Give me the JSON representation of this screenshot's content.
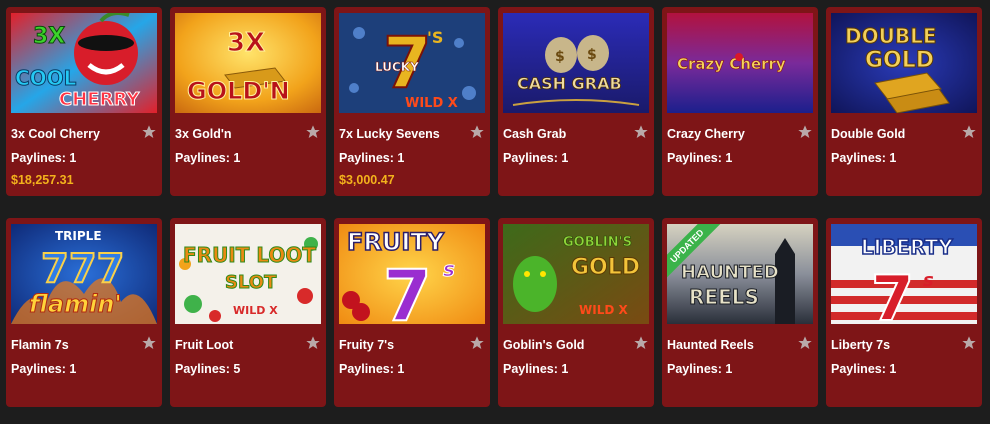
{
  "games": [
    {
      "name": "3x Cool Cherry",
      "paylines": "Paylines: 1",
      "jackpot": "$18,257.31"
    },
    {
      "name": "3x Gold'n",
      "paylines": "Paylines: 1",
      "jackpot": ""
    },
    {
      "name": "7x Lucky Sevens",
      "paylines": "Paylines: 1",
      "jackpot": "$3,000.47"
    },
    {
      "name": "Cash Grab",
      "paylines": "Paylines: 1",
      "jackpot": ""
    },
    {
      "name": "Crazy Cherry",
      "paylines": "Paylines: 1",
      "jackpot": ""
    },
    {
      "name": "Double Gold",
      "paylines": "Paylines: 1",
      "jackpot": ""
    },
    {
      "name": "Flamin 7s",
      "paylines": "Paylines: 1",
      "jackpot": ""
    },
    {
      "name": "Fruit Loot",
      "paylines": "Paylines: 5",
      "jackpot": ""
    },
    {
      "name": "Fruity 7's",
      "paylines": "Paylines: 1",
      "jackpot": ""
    },
    {
      "name": "Goblin's Gold",
      "paylines": "Paylines: 1",
      "jackpot": ""
    },
    {
      "name": "Haunted Reels",
      "paylines": "Paylines: 1",
      "jackpot": "",
      "badge": "UPDATED"
    },
    {
      "name": "Liberty 7s",
      "paylines": "Paylines: 1",
      "jackpot": ""
    }
  ],
  "thumb_text": {
    "cool_cherry": [
      "3X",
      "COOL",
      "CHERRY"
    ],
    "goldn": [
      "3X",
      "GOLD'N"
    ],
    "lucky": [
      "7",
      "'S",
      "LUCKY",
      "WILD X"
    ],
    "cash_grab": [
      "CASH GRAB"
    ],
    "crazy_cherry": [
      "Crazy Cherry"
    ],
    "double_gold": [
      "DOUBLE",
      "GOLD"
    ],
    "flamin": [
      "TRIPLE",
      "777",
      "flamin'"
    ],
    "fruit_loot": [
      "FRUIT LOOT",
      "SLOT",
      "WILD X"
    ],
    "fruity": [
      "FRUITY",
      "7",
      "s"
    ],
    "goblin": [
      "GOBLIN'S",
      "GOLD",
      "WILD X"
    ],
    "haunted": [
      "HAUNTED",
      "REELS"
    ],
    "liberty": [
      "LIBERTY",
      "7",
      "s"
    ]
  },
  "colors": {
    "card_bg": "#7e1517",
    "page_bg": "#1d1d1d",
    "jackpot": "#f3b21c",
    "star": "#b9a9a9",
    "badge": "#3bb34a"
  },
  "icons": {
    "favorite": "star-icon"
  }
}
